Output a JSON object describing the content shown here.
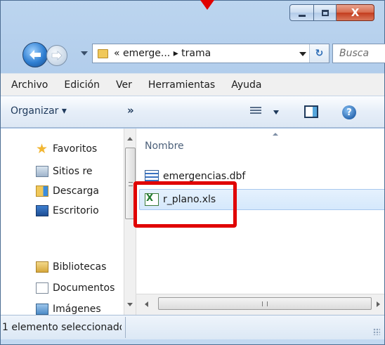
{
  "window": {
    "caption": {
      "minimize": "",
      "maximize": "",
      "close": "X"
    }
  },
  "address_bar": {
    "path": "« emerge... ▸ trama",
    "search_placeholder": "Busca"
  },
  "menu": {
    "items": [
      "Archivo",
      "Edición",
      "Ver",
      "Herramientas",
      "Ayuda"
    ]
  },
  "command_bar": {
    "organize_label": "Organizar ▾",
    "more": "»",
    "help": "?"
  },
  "nav_pane": {
    "favorites": "Favoritos",
    "items": [
      {
        "label": "Sitios re",
        "icon": "sites-icon"
      },
      {
        "label": "Descarga",
        "icon": "downloads-icon"
      },
      {
        "label": "Escritorio",
        "icon": "desktop-icon"
      }
    ],
    "libraries": "Bibliotecas",
    "lib_items": [
      {
        "label": "Documentos",
        "icon": "documents-icon"
      },
      {
        "label": "Imágenes",
        "icon": "images-icon"
      }
    ]
  },
  "content": {
    "column_header": "Nombre",
    "files": [
      {
        "name": "emergencias.dbf",
        "icon": "dbf-file-icon",
        "selected": false
      },
      {
        "name": "r_plano.xls",
        "icon": "excel-file-icon",
        "selected": true
      }
    ]
  },
  "status": {
    "text": "1 elemento seleccionado"
  },
  "colors": {
    "highlight": "#e00000",
    "selection": "#d5e8fc",
    "chrome": "#bcd5ef"
  }
}
